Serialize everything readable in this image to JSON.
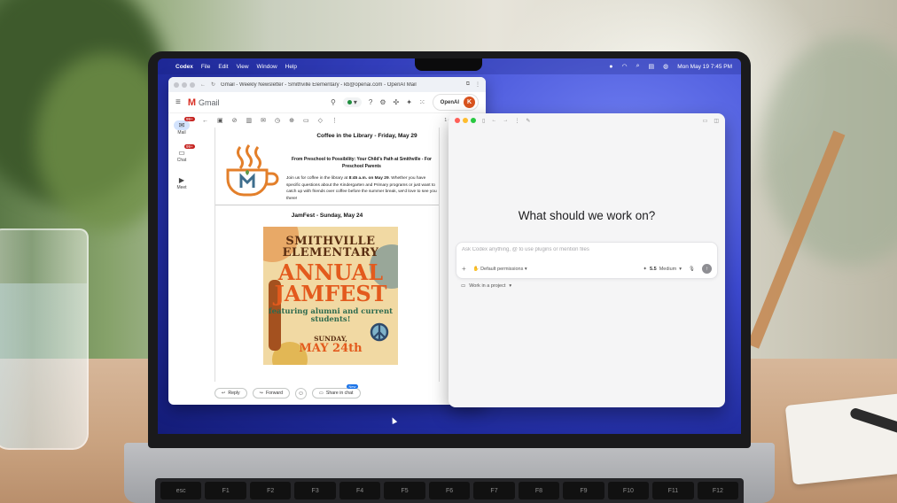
{
  "menubar": {
    "app": "Codex",
    "items": [
      "File",
      "Edit",
      "View",
      "Window",
      "Help"
    ],
    "clock": "Mon May 19  7:45 PM"
  },
  "gmail": {
    "tab_title": "Gmail - Weekly Newsletter - Smithville Elementary - kb@openai.com - OpenAI Mail",
    "brand": "Gmail",
    "account_label": "OpenAI",
    "avatar_letter": "K",
    "rail": [
      {
        "label": "Mail",
        "badge": "99+"
      },
      {
        "label": "Chat",
        "badge": "99+"
      },
      {
        "label": "Meet",
        "badge": ""
      }
    ],
    "pager": "1 of 1,243",
    "newsletter": {
      "coffee_heading": "Coffee in the Library - Friday, May 29",
      "coffee_subheading": "From Preschool to Possibility: Your Child's Path at Smithville - For Preschool Parents",
      "coffee_body_1": "Join us for coffee in the library at ",
      "coffee_time": "8:45 a.m. on May 29",
      "coffee_body_2": ". Whether you have specific questions about the Kindergarten and Primary programs or just want to catch up with friends over coffee before the summer break, we'd love to see you there!",
      "jamfest_heading": "JamFest - Sunday, May 24",
      "poster": {
        "line1": "SMITHVILLE ELEMENTARY",
        "line2": "ANNUAL",
        "line3": "JAMFEST",
        "line4": "featuring alumni and current students!",
        "line5": "SUNDAY,",
        "line6": "MAY 24th"
      }
    },
    "actions": {
      "reply": "Reply",
      "forward": "Forward",
      "share": "Share in chat",
      "share_badge": "New"
    }
  },
  "codex": {
    "heading": "What should we work on?",
    "composer_placeholder": "Ask Codex anything, @ to use plugins or mention files",
    "permissions": "Default permissions",
    "model_version": "5.5",
    "model_effort": "Medium",
    "project": "Work in a project"
  },
  "keyboard": {
    "keys": [
      "esc",
      "F1",
      "F2",
      "F3",
      "F4",
      "F5",
      "F6",
      "F7",
      "F8",
      "F9",
      "F10",
      "F11",
      "F12"
    ]
  }
}
